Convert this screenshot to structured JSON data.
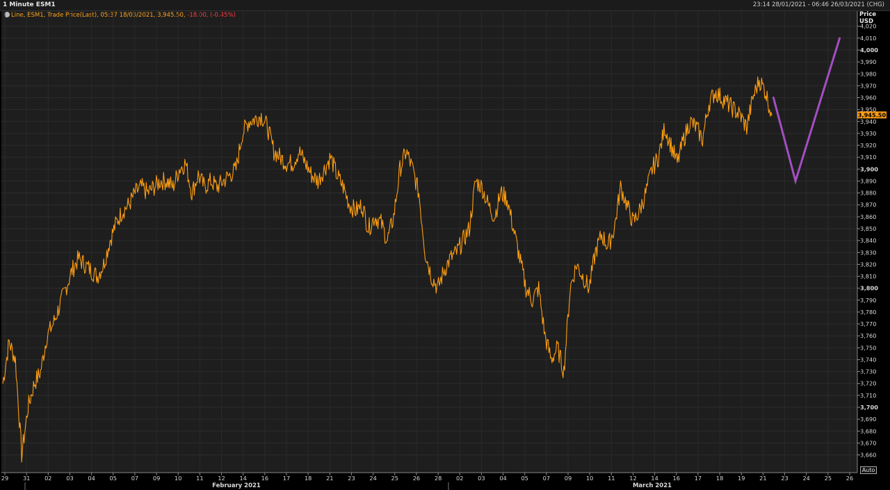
{
  "window": {
    "title": "1 Minute ESM1",
    "range": "23:14 28/01/2021 - 06:46 26/03/2021 (CHG)"
  },
  "legend": {
    "prefix": "Line, ESM1, Trade Price(Last), 05:37 18/03/2021, 3,945.50, ",
    "change": "-18.00, (-0.45%)"
  },
  "axis": {
    "price_label": "Price",
    "currency_label": "USD",
    "last_price_badge": "3,945.50",
    "auto_button": "Auto"
  },
  "colors": {
    "series": "#ff9e12",
    "projection": "#a34fc2",
    "badge_bg": "#ff9e12",
    "negative": "#ff3b3b"
  },
  "chart_data": {
    "type": "line",
    "title": "1 Minute ESM1",
    "ylabel": "Price USD",
    "ylim": [
      3650,
      4025
    ],
    "y_ticks": [
      3660,
      3670,
      3680,
      3690,
      3700,
      3710,
      3720,
      3730,
      3740,
      3750,
      3760,
      3770,
      3780,
      3790,
      3800,
      3810,
      3820,
      3830,
      3840,
      3850,
      3860,
      3870,
      3880,
      3890,
      3900,
      3910,
      3920,
      3930,
      3940,
      3950,
      3960,
      3970,
      3980,
      3990,
      4000,
      4010,
      4020
    ],
    "y_tick_labels": [
      "3,660",
      "3,670",
      "3,680",
      "3,690",
      "3,700",
      "3,710",
      "3,720",
      "3,730",
      "3,740",
      "3,750",
      "3,760",
      "3,770",
      "3,780",
      "3,790",
      "3,800",
      "3,810",
      "3,820",
      "3,830",
      "3,840",
      "3,850",
      "3,860",
      "3,870",
      "3,880",
      "3,890",
      "3,900",
      "3,910",
      "3,920",
      "3,930",
      "3,940",
      "3,950",
      "3,960",
      "3,970",
      "3,980",
      "3,990",
      "4,000",
      "4,010",
      "4,020"
    ],
    "y_bold_ticks": [
      3700,
      3800,
      3900,
      4000
    ],
    "x_day_labels": [
      "29",
      "31",
      "02",
      "03",
      "04",
      "05",
      "07",
      "09",
      "10",
      "11",
      "12",
      "14",
      "16",
      "17",
      "18",
      "21",
      "23",
      "24",
      "25",
      "26",
      "28",
      "02",
      "03",
      "04",
      "05",
      "07",
      "09",
      "10",
      "11",
      "12",
      "14",
      "16",
      "17",
      "18",
      "19",
      "21",
      "23",
      "24",
      "25",
      "26"
    ],
    "x_months": [
      "February 2021",
      "March 2021"
    ],
    "series": [
      {
        "name": "ESM1",
        "kind": "trade-price",
        "points": [
          [
            0,
            3720
          ],
          [
            4,
            3755
          ],
          [
            8,
            3740
          ],
          [
            12,
            3660
          ],
          [
            16,
            3700
          ],
          [
            20,
            3720
          ],
          [
            24,
            3730
          ],
          [
            28,
            3760
          ],
          [
            32,
            3770
          ],
          [
            36,
            3785
          ],
          [
            40,
            3800
          ],
          [
            44,
            3815
          ],
          [
            48,
            3825
          ],
          [
            52,
            3820
          ],
          [
            56,
            3815
          ],
          [
            60,
            3810
          ],
          [
            64,
            3820
          ],
          [
            68,
            3840
          ],
          [
            72,
            3855
          ],
          [
            76,
            3865
          ],
          [
            80,
            3870
          ],
          [
            84,
            3880
          ],
          [
            88,
            3885
          ],
          [
            92,
            3880
          ],
          [
            96,
            3885
          ],
          [
            100,
            3890
          ],
          [
            104,
            3890
          ],
          [
            108,
            3885
          ],
          [
            112,
            3900
          ],
          [
            116,
            3905
          ],
          [
            120,
            3880
          ],
          [
            124,
            3895
          ],
          [
            128,
            3885
          ],
          [
            132,
            3890
          ],
          [
            136,
            3885
          ],
          [
            140,
            3890
          ],
          [
            144,
            3895
          ],
          [
            148,
            3900
          ],
          [
            152,
            3930
          ],
          [
            156,
            3940
          ],
          [
            160,
            3942
          ],
          [
            164,
            3945
          ],
          [
            168,
            3935
          ],
          [
            172,
            3915
          ],
          [
            176,
            3910
          ],
          [
            180,
            3905
          ],
          [
            184,
            3905
          ],
          [
            188,
            3915
          ],
          [
            192,
            3905
          ],
          [
            196,
            3895
          ],
          [
            200,
            3890
          ],
          [
            204,
            3900
          ],
          [
            208,
            3910
          ],
          [
            212,
            3895
          ],
          [
            216,
            3885
          ],
          [
            220,
            3870
          ],
          [
            224,
            3865
          ],
          [
            228,
            3870
          ],
          [
            232,
            3850
          ],
          [
            236,
            3860
          ],
          [
            240,
            3855
          ],
          [
            244,
            3840
          ],
          [
            248,
            3860
          ],
          [
            252,
            3900
          ],
          [
            256,
            3915
          ],
          [
            260,
            3900
          ],
          [
            264,
            3880
          ],
          [
            268,
            3830
          ],
          [
            272,
            3810
          ],
          [
            276,
            3800
          ],
          [
            280,
            3815
          ],
          [
            284,
            3825
          ],
          [
            288,
            3830
          ],
          [
            292,
            3840
          ],
          [
            296,
            3850
          ],
          [
            300,
            3890
          ],
          [
            304,
            3885
          ],
          [
            308,
            3870
          ],
          [
            312,
            3860
          ],
          [
            316,
            3880
          ],
          [
            320,
            3875
          ],
          [
            324,
            3850
          ],
          [
            328,
            3825
          ],
          [
            332,
            3800
          ],
          [
            336,
            3790
          ],
          [
            340,
            3800
          ],
          [
            344,
            3760
          ],
          [
            348,
            3740
          ],
          [
            352,
            3750
          ],
          [
            356,
            3730
          ],
          [
            360,
            3800
          ],
          [
            364,
            3820
          ],
          [
            368,
            3810
          ],
          [
            372,
            3800
          ],
          [
            376,
            3830
          ],
          [
            380,
            3845
          ],
          [
            384,
            3835
          ],
          [
            388,
            3850
          ],
          [
            392,
            3885
          ],
          [
            396,
            3870
          ],
          [
            400,
            3855
          ],
          [
            404,
            3865
          ],
          [
            408,
            3880
          ],
          [
            412,
            3900
          ],
          [
            416,
            3910
          ],
          [
            420,
            3935
          ],
          [
            424,
            3920
          ],
          [
            428,
            3905
          ],
          [
            432,
            3925
          ],
          [
            436,
            3940
          ],
          [
            440,
            3935
          ],
          [
            444,
            3925
          ],
          [
            448,
            3955
          ],
          [
            452,
            3965
          ],
          [
            456,
            3960
          ],
          [
            460,
            3955
          ],
          [
            464,
            3950
          ],
          [
            468,
            3945
          ],
          [
            472,
            3935
          ],
          [
            476,
            3960
          ],
          [
            480,
            3975
          ],
          [
            484,
            3965
          ],
          [
            488,
            3945
          ]
        ]
      },
      {
        "name": "Projection",
        "kind": "annotation",
        "points": [
          [
            489,
            3960
          ],
          [
            503,
            3890
          ],
          [
            531,
            4010
          ]
        ]
      }
    ]
  }
}
